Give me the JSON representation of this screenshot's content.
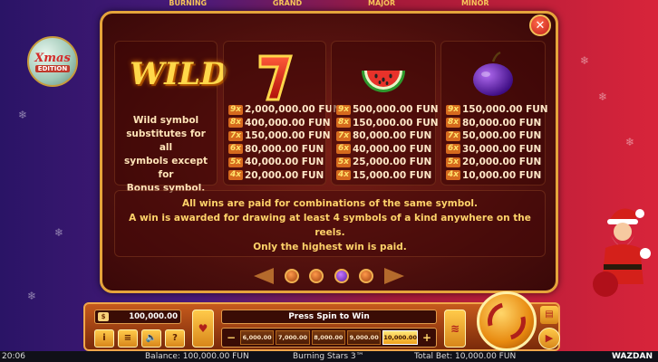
{
  "top_labels": [
    "BURNING",
    "GRAND",
    "MAJOR",
    "MINOR"
  ],
  "ornament": {
    "line1": "Xmas",
    "line2": "EDITION"
  },
  "wild": {
    "logo": "WILD",
    "description_lines": [
      "Wild symbol",
      "substitutes for all",
      "symbols except for",
      "Bonus symbol."
    ]
  },
  "paytable": [
    {
      "symbol": "seven",
      "icon": "seven-icon",
      "rows": [
        {
          "mult": "9x",
          "value": "2,000,000.00 FUN"
        },
        {
          "mult": "8x",
          "value": "400,000.00 FUN"
        },
        {
          "mult": "7x",
          "value": "150,000.00 FUN"
        },
        {
          "mult": "6x",
          "value": "80,000.00 FUN"
        },
        {
          "mult": "5x",
          "value": "40,000.00 FUN"
        },
        {
          "mult": "4x",
          "value": "20,000.00 FUN"
        }
      ]
    },
    {
      "symbol": "watermelon",
      "icon": "watermelon-icon",
      "rows": [
        {
          "mult": "9x",
          "value": "500,000.00 FUN"
        },
        {
          "mult": "8x",
          "value": "150,000.00 FUN"
        },
        {
          "mult": "7x",
          "value": "80,000.00 FUN"
        },
        {
          "mult": "6x",
          "value": "40,000.00 FUN"
        },
        {
          "mult": "5x",
          "value": "25,000.00 FUN"
        },
        {
          "mult": "4x",
          "value": "15,000.00 FUN"
        }
      ]
    },
    {
      "symbol": "plum",
      "icon": "plum-icon",
      "rows": [
        {
          "mult": "9x",
          "value": "150,000.00 FUN"
        },
        {
          "mult": "8x",
          "value": "80,000.00 FUN"
        },
        {
          "mult": "7x",
          "value": "50,000.00 FUN"
        },
        {
          "mult": "6x",
          "value": "30,000.00 FUN"
        },
        {
          "mult": "5x",
          "value": "20,000.00 FUN"
        },
        {
          "mult": "4x",
          "value": "10,000.00 FUN"
        }
      ]
    }
  ],
  "rules": [
    "All wins are paid for combinations of the same symbol.",
    "A win is awarded for drawing at least 4 symbols of a kind anywhere on the reels.",
    "Only the highest win is paid."
  ],
  "pager": {
    "count": 4,
    "active_index": 2
  },
  "controls": {
    "balance_box": "100,000.00",
    "message": "Press Spin to Win",
    "minus": "−",
    "plus": "+",
    "bet_options": [
      "6,000.00",
      "7,000.00",
      "8,000.00",
      "9,000.00",
      "10,000.00"
    ],
    "selected_bet_index": 4,
    "info": "i",
    "menu": "≡",
    "sound": "🔈",
    "help": "?"
  },
  "status": {
    "clock": "20:06",
    "balance": "Balance: 100,000.00 FUN",
    "game": "Burning Stars 3™",
    "total_bet": "Total Bet: 10,000.00 FUN",
    "brand": "WAZDAN"
  },
  "colors": {
    "accent": "#e5a43b",
    "panel": "#4a0e0c",
    "text_gold": "#ffd36a"
  }
}
